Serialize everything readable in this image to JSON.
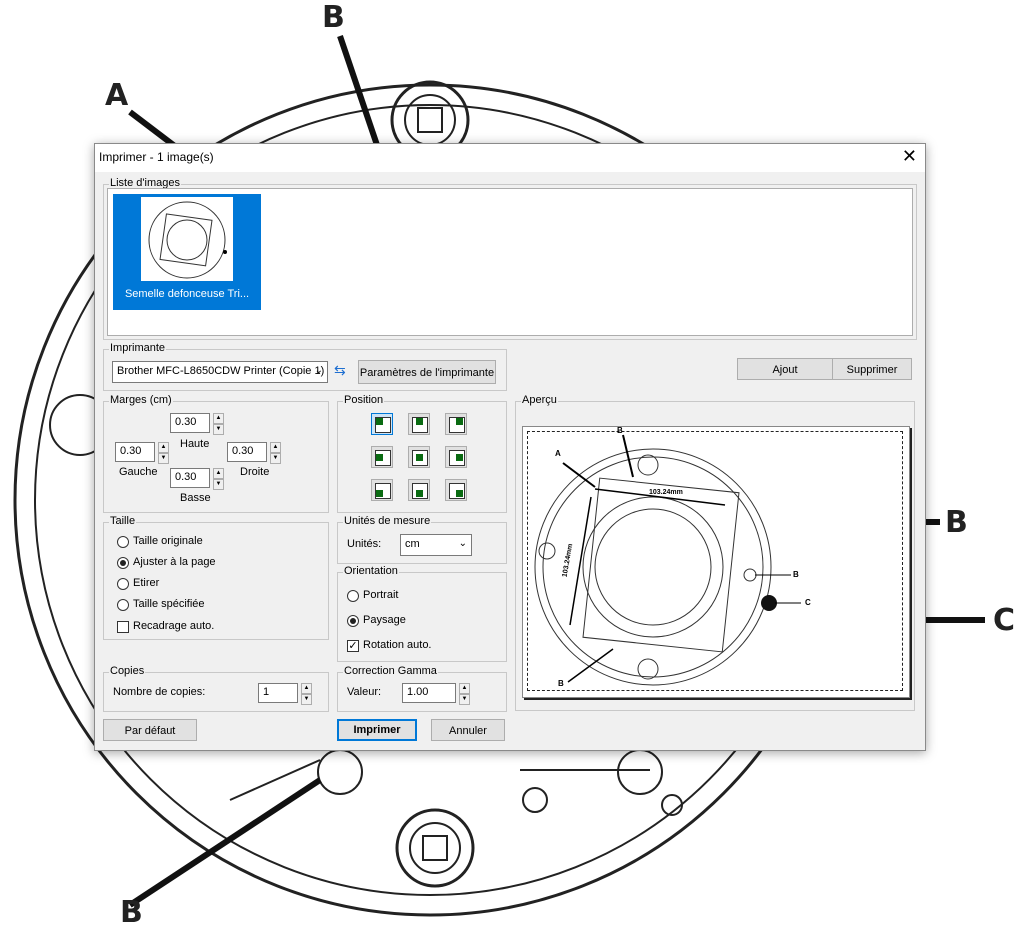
{
  "background": {
    "labels": [
      "A",
      "B",
      "B",
      "C",
      "B"
    ]
  },
  "dialog": {
    "title": "Imprimer  -  1 image(s)",
    "close_glyph": "✕",
    "image_list": {
      "legend": "Liste d'images",
      "items": [
        {
          "caption": "Semelle defonceuse Tri..."
        }
      ]
    },
    "printer": {
      "legend": "Imprimante",
      "selected": "Brother MFC-L8650CDW Printer (Copie 1)",
      "settings_button": "Paramètres de l'imprimante",
      "refresh_icon": "refresh-icon"
    },
    "add_button": "Ajout",
    "delete_button": "Supprimer",
    "margins": {
      "legend": "Marges (cm)",
      "top_value": "0.30",
      "top_label": "Haute",
      "left_value": "0.30",
      "left_label": "Gauche",
      "right_value": "0.30",
      "right_label": "Droite",
      "bottom_value": "0.30",
      "bottom_label": "Basse"
    },
    "position": {
      "legend": "Position",
      "selected": "top-left"
    },
    "preview": {
      "legend": "Aperçu",
      "labels": [
        "A",
        "B",
        "B",
        "C",
        "B"
      ],
      "dimension_h": "103.24mm",
      "dimension_v": "103.24mm"
    },
    "size": {
      "legend": "Taille",
      "options": [
        "Taille originale",
        "Ajuster à la page",
        "Etirer",
        "Taille spécifiée"
      ],
      "selected_index": 1,
      "auto_crop_label": "Recadrage auto.",
      "auto_crop_checked": false
    },
    "units": {
      "legend": "Unités de mesure",
      "label": "Unités:",
      "value": "cm"
    },
    "orientation": {
      "legend": "Orientation",
      "portrait_label": "Portrait",
      "landscape_label": "Paysage",
      "selected": "Paysage",
      "auto_rotate_label": "Rotation auto.",
      "auto_rotate_checked": true
    },
    "copies": {
      "legend": "Copies",
      "label": "Nombre de copies:",
      "value": "1"
    },
    "gamma": {
      "legend": "Correction Gamma",
      "label": "Valeur:",
      "value": "1.00"
    },
    "default_button": "Par défaut",
    "print_button": "Imprimer",
    "cancel_button": "Annuler"
  }
}
